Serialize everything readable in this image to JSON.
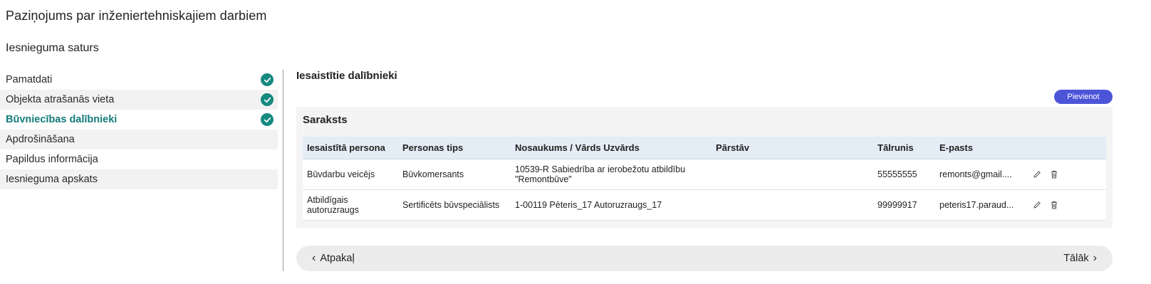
{
  "page": {
    "title": "Paziņojums par inženiertehniskajiem darbiem",
    "section_title": "Iesnieguma saturs"
  },
  "sidebar": {
    "steps": [
      {
        "label": "Pamatdati",
        "completed": true
      },
      {
        "label": "Objekta atrašanās vieta",
        "completed": true
      },
      {
        "label": "Būvniecības dalībnieki",
        "completed": true,
        "active": true
      },
      {
        "label": "Apdrošināšana",
        "completed": false
      },
      {
        "label": "Papildus informācija",
        "completed": false
      },
      {
        "label": "Iesnieguma apskats",
        "completed": false
      }
    ]
  },
  "main": {
    "heading": "Iesaistītie dalībnieki",
    "add_button_label": "Pievienot",
    "card_title": "Saraksts",
    "table": {
      "headers": [
        "Iesaistītā persona",
        "Personas tips",
        "Nosaukums / Vārds Uzvārds",
        "Pārstāv",
        "Tālrunis",
        "E-pasts"
      ],
      "rows": [
        {
          "role": "Būvdarbu veicējs",
          "type": "Būvkomersants",
          "name": "10539-R Sabiedrība ar ierobežotu atbildību \"Remontbūve\"",
          "represents": "",
          "phone": "55555555",
          "email": "remonts@gmail...."
        },
        {
          "role": "Atbildīgais autoruzraugs",
          "type": "Sertificēts būvspeciālists",
          "name": "1-00119 Pēteris_17 Autoruzraugs_17",
          "represents": "",
          "phone": "99999917",
          "email": "peteris17.paraud..."
        }
      ]
    }
  },
  "navigation": {
    "back_label": "Atpakaļ",
    "next_label": "Tālāk"
  },
  "colors": {
    "accent_teal": "#168a7f",
    "active_step_text": "#137c79",
    "primary_button": "#4c55d8",
    "table_header_bg": "#e4ecf5"
  },
  "icons": {
    "step_complete": "check-circle-icon",
    "edit": "pencil-icon",
    "delete": "trash-icon",
    "back": "chevron-left-icon",
    "next": "chevron-right-icon"
  }
}
